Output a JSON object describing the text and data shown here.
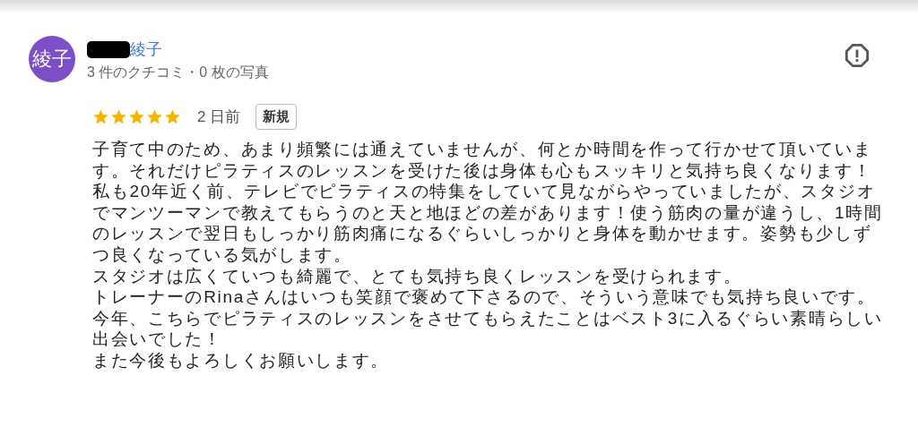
{
  "review": {
    "avatar": "綾子",
    "author": "綾子",
    "meta": "3 件のクチコミ・0 枚の写真",
    "stars": 5,
    "date": "2 日前",
    "badge": "新規",
    "paragraphs": [
      "子育て中のため、あまり頻繁には通えていませんが、何とか時間を作って行かせて頂いています。それだけピラティスのレッスンを受けた後は身体も心もスッキリと気持ち良くなります！",
      "私も20年近く前、テレビでピラティスの特集をしていて見ながらやっていましたが、スタジオでマンツーマンで教えてもらうのと天と地ほどの差があります！使う筋肉の量が違うし、1時間のレッスンで翌日もしっかり筋肉痛になるぐらいしっかりと身体を動かせます。姿勢も少しずつ良くなっている気がします。",
      "スタジオは広くていつも綺麗で、とても気持ち良くレッスンを受けられます。",
      "トレーナーのRinaさんはいつも笑顔で褒めて下さるので、そういう意味でも気持ち良いです。",
      "今年、こちらでピラティスのレッスンをさせてもらえたことはベスト3に入るぐらい素晴らしい出会いでした！",
      "また今後もよろしくお願いします。"
    ]
  }
}
